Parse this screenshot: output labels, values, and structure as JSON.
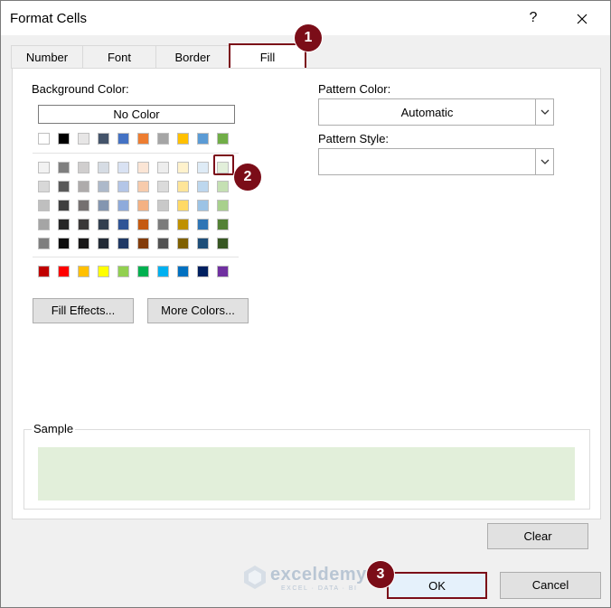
{
  "window": {
    "title": "Format Cells",
    "help": "?"
  },
  "tabs": [
    {
      "label": "Number"
    },
    {
      "label": "Font"
    },
    {
      "label": "Border"
    },
    {
      "label": "Fill"
    }
  ],
  "fill": {
    "background_color_label": "Background Color:",
    "no_color_label": "No Color",
    "pattern_color_label": "Pattern Color:",
    "pattern_color_value": "Automatic",
    "pattern_style_label": "Pattern Style:",
    "pattern_style_value": "",
    "fill_effects_label": "Fill Effects...",
    "more_colors_label": "More Colors...",
    "sample_label": "Sample",
    "sample_color": "#e2efda",
    "selected_color": "#e2efda",
    "palette": {
      "row1": [
        "#ffffff",
        "#000000",
        "#e7e6e6",
        "#44546a",
        "#4472c4",
        "#ed7d31",
        "#a5a5a5",
        "#ffc000",
        "#5b9bd5",
        "#70ad47"
      ],
      "shades": [
        [
          "#f2f2f2",
          "#7f7f7f",
          "#d0cece",
          "#d6dce4",
          "#d9e2f3",
          "#fbe5d5",
          "#ededed",
          "#fff2cc",
          "#deebf6",
          "#e2efda"
        ],
        [
          "#d8d8d8",
          "#595959",
          "#aeabab",
          "#adb9ca",
          "#b4c6e7",
          "#f7cbac",
          "#dbdbdb",
          "#fee599",
          "#bdd7ee",
          "#c5e0b3"
        ],
        [
          "#bfbfbf",
          "#3f3f3f",
          "#757070",
          "#8496b0",
          "#8eaadb",
          "#f4b183",
          "#c9c9c9",
          "#ffd965",
          "#9cc3e5",
          "#a8d08d"
        ],
        [
          "#a5a5a5",
          "#262626",
          "#3a3838",
          "#323f4f",
          "#2f5496",
          "#c55a11",
          "#7b7b7b",
          "#bf9000",
          "#2e75b5",
          "#538135"
        ],
        [
          "#7f7f7f",
          "#0c0c0c",
          "#171616",
          "#222a35",
          "#1f3864",
          "#833c0b",
          "#525252",
          "#7f6000",
          "#1e4e79",
          "#375623"
        ]
      ],
      "standard": [
        "#c00000",
        "#ff0000",
        "#ffc000",
        "#ffff00",
        "#92d050",
        "#00b050",
        "#00b0f0",
        "#0070c0",
        "#002060",
        "#7030a0"
      ]
    }
  },
  "buttons": {
    "clear": "Clear",
    "ok": "OK",
    "cancel": "Cancel"
  },
  "callouts": [
    "1",
    "2",
    "3"
  ],
  "watermark": {
    "name": "exceldemy",
    "sub": "EXCEL · DATA · BI"
  }
}
